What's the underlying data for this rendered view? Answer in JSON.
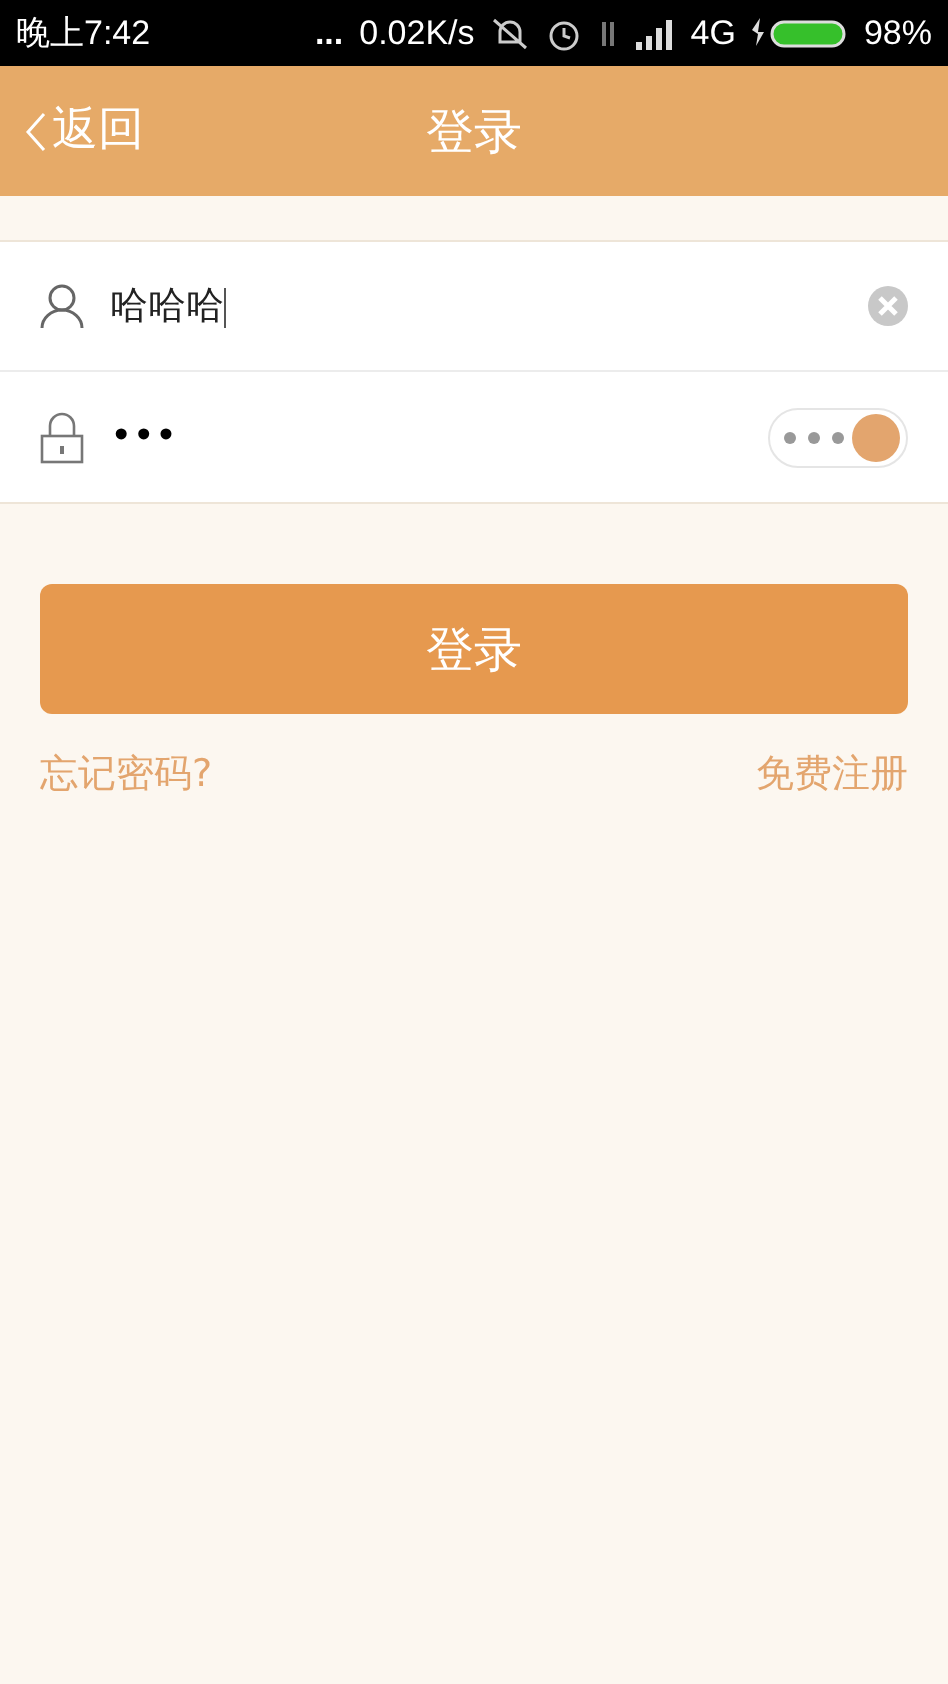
{
  "status_bar": {
    "time": "晚上7:42",
    "dots": "...",
    "speed": "0.02K/s",
    "network": "4G",
    "battery": "98%"
  },
  "nav": {
    "back": "返回",
    "title": "登录"
  },
  "username": {
    "value": "哈哈哈"
  },
  "password": {
    "value": "•••",
    "show_toggle": {
      "on": true
    }
  },
  "login_button": "登录",
  "forgot": "忘记密码?",
  "register": "免费注册"
}
